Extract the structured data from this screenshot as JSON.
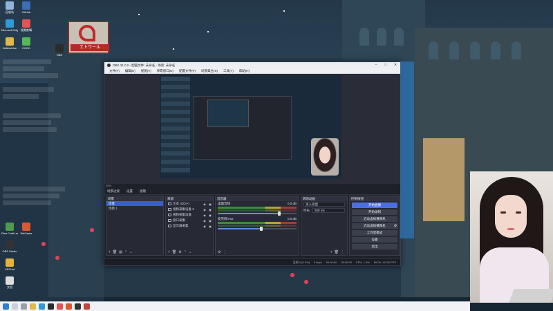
{
  "colors": {
    "accent": "#4c6fe0",
    "obs_bg": "#1f2129",
    "dock_bg": "#272a34",
    "selected": "#3d5cc9",
    "wallpaper": "#2f4c5e"
  },
  "desktop": {
    "icons": [
      {
        "label": "回收站",
        "icon": "recycle-bin-icon",
        "color": "#8fb3d9"
      },
      {
        "label": "GitHub",
        "icon": "app-icon",
        "color": "#3b6fb6"
      },
      {
        "label": "Microsoft Edge",
        "icon": "edge-icon",
        "color": "#2f9bd6"
      },
      {
        "label": "视频剪辑",
        "icon": "app-icon",
        "color": "#e55353"
      },
      {
        "label": "NoMachine",
        "icon": "folder-icon",
        "color": "#e0b94d"
      },
      {
        "label": "KOOK",
        "icon": "app-icon",
        "color": "#55b85a"
      },
      {
        "label": "OBS",
        "icon": "obs-icon",
        "color": "#2b2b2b"
      },
      {
        "label": "Plan Craft Launcher",
        "icon": "app-icon",
        "color": "#4e9a4e"
      },
      {
        "label": "WeGame",
        "icon": "app-icon",
        "color": "#d85a33"
      },
      {
        "label": "OBS Studio",
        "icon": "obs-icon",
        "color": "#333333"
      },
      {
        "label": "VRChat",
        "icon": "app-icon",
        "color": "#e2b43a"
      },
      {
        "label": "文档",
        "icon": "file-icon",
        "color": "#dcdcdc"
      }
    ]
  },
  "obs": {
    "title": "OBS 31.0.0 - 配置文件: 未命名 - 场景: 未命名",
    "menu": [
      "文件(F)",
      "编辑(E)",
      "视图(V)",
      "停靠窗口(D)",
      "配置文件(P)",
      "场景集合(S)",
      "工具(T)",
      "帮助(H)"
    ],
    "preview_status": "25%",
    "tabs": [
      "场景过渡",
      "设置",
      "滤镜"
    ],
    "scenes": {
      "title": "场景",
      "items": [
        "场景",
        "场景 1"
      ],
      "selected": 0
    },
    "sources": {
      "title": "来源",
      "items": [
        {
          "name": "文本 (GDI+)",
          "icon": "text-source-icon"
        },
        {
          "name": "视频采集设备 2",
          "icon": "camera-source-icon"
        },
        {
          "name": "视频采集设备",
          "icon": "camera-source-icon"
        },
        {
          "name": "窗口采集",
          "icon": "window-source-icon"
        },
        {
          "name": "显示器采集",
          "icon": "monitor-source-icon"
        }
      ]
    },
    "mixer": {
      "title": "混音器",
      "channels": [
        {
          "name": "桌面音频",
          "db": "0.0 dB",
          "level": 0.78
        },
        {
          "name": "麦克风/Aux",
          "db": "0.0 dB",
          "level": 0.55
        }
      ]
    },
    "transitions": {
      "title": "转场动画",
      "type": "淡入淡出",
      "duration_label": "时长",
      "duration": "300 ms"
    },
    "controls": {
      "title": "控制按钮",
      "buttons": [
        "开始直播",
        "开始录制",
        "启动虚拟摄像机",
        "启动虚拟摄像机",
        "工作室模式",
        "设置",
        "退出"
      ],
      "primary_index": 0
    },
    "status": [
      "丢帧 0 (0.0%)",
      "0 kbps",
      "00:00:00",
      "00:00:00",
      "CPU: 1.0%",
      "60.00 / 60.00 FPS"
    ]
  }
}
